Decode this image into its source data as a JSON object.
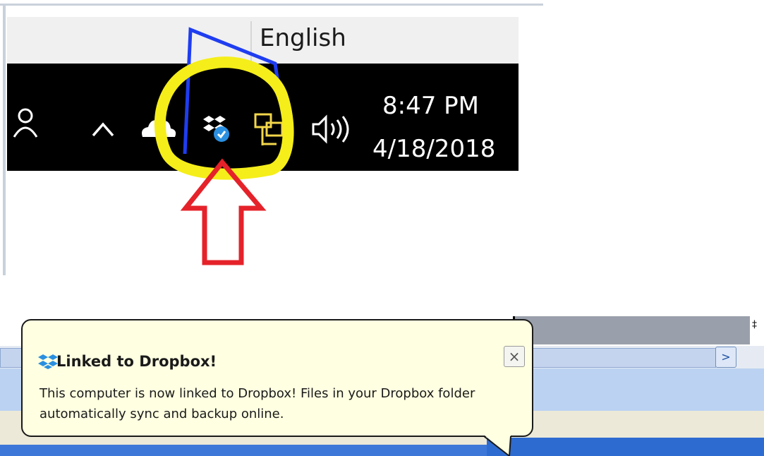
{
  "language_bar": {
    "label": "English"
  },
  "tray": {
    "people_icon": "people-icon",
    "chevron_glyph": "^",
    "volume_glyph": "◁))",
    "clock_time": "8:47 PM",
    "clock_date": "4/18/2018"
  },
  "annotations": {
    "highlight_color": "#f5ee1a",
    "arrow_color": "#e5222a",
    "line_color": "#1f3df0"
  },
  "notification": {
    "title": "Linked to Dropbox!",
    "body": "This computer is now linked to Dropbox! Files in your Dropbox folder automatically sync and backup online.",
    "close_glyph": "×"
  },
  "window": {
    "go_glyph": ">",
    "pin_glyph": "‡"
  },
  "colors": {
    "taskbar": "#000000",
    "balloon_bg": "#ffffe1",
    "dropbox_blue": "#2a8fe0"
  }
}
